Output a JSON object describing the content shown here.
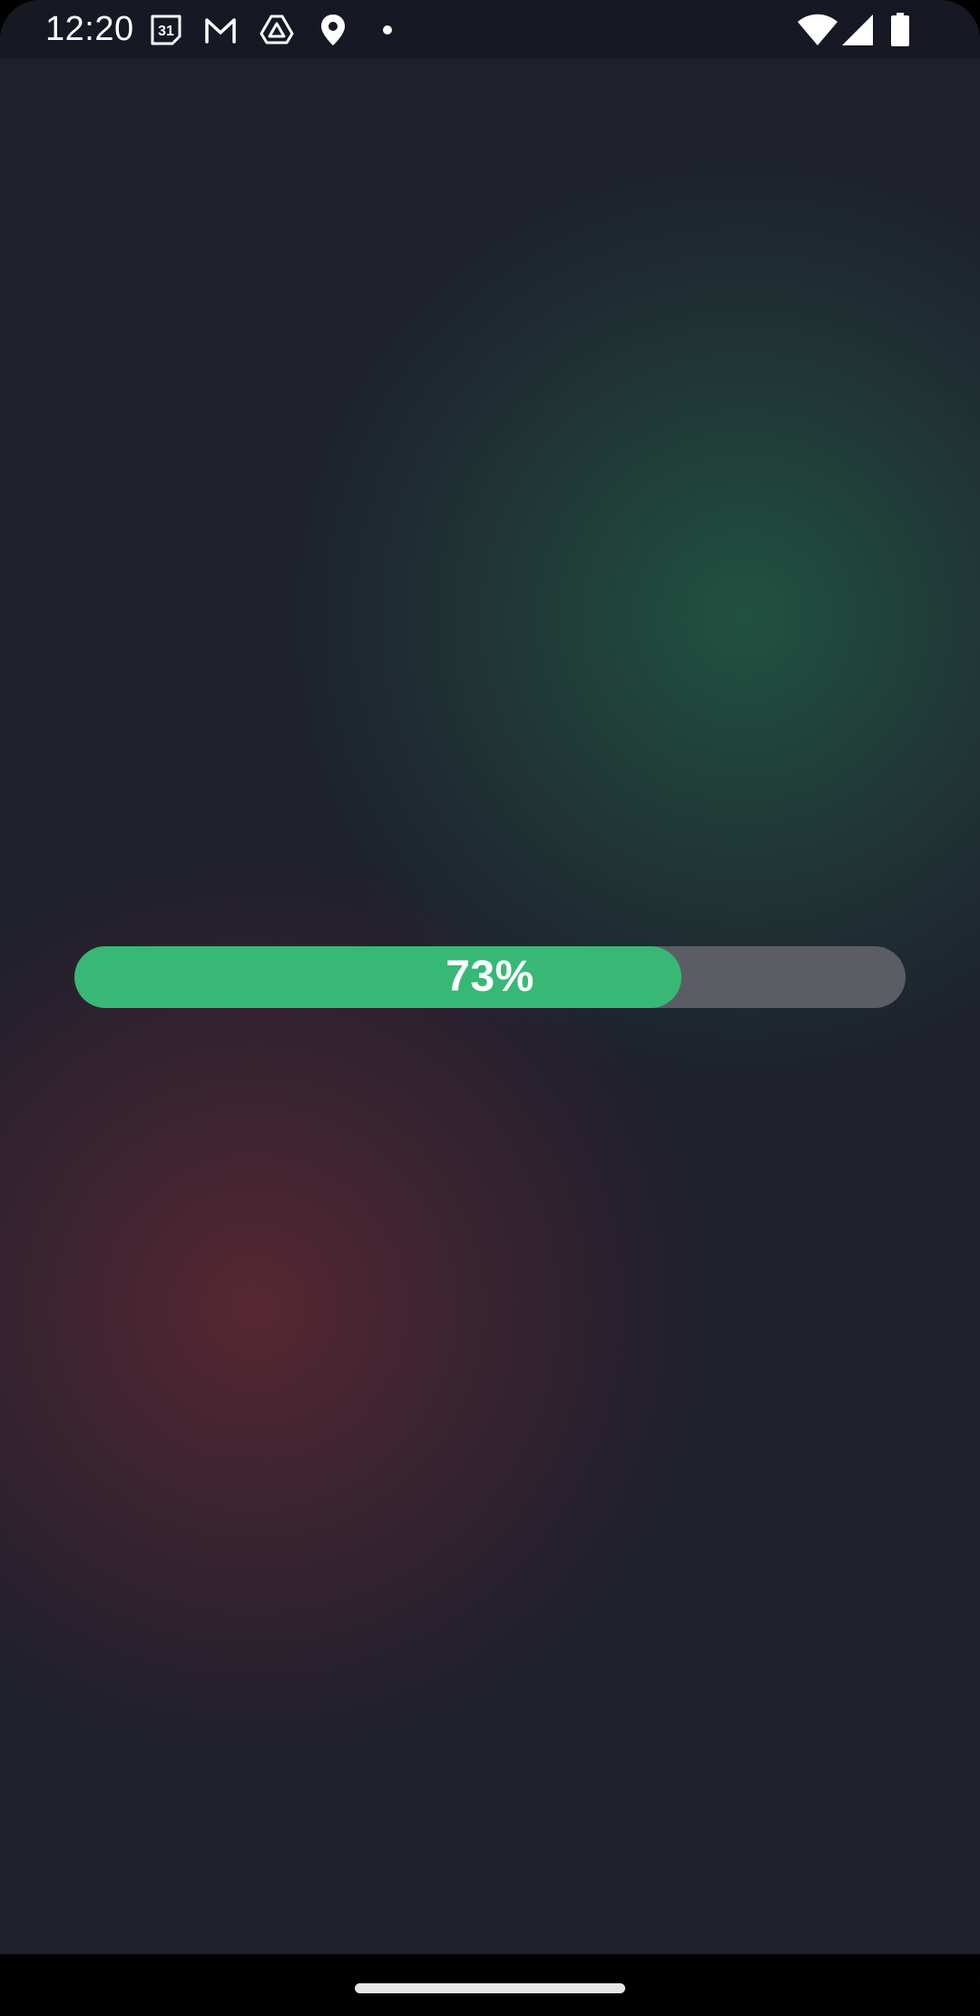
{
  "status_bar": {
    "time": "12:20",
    "notification_icons": [
      "calendar-icon",
      "gmail-icon",
      "drive-icon",
      "location-pin-icon",
      "more-dot-icon"
    ],
    "calendar_day": "31",
    "system_icons": [
      "wifi-icon",
      "cellular-signal-icon",
      "battery-icon"
    ]
  },
  "progress": {
    "value": 0.73,
    "label": "73%",
    "fill_color": "#37b975",
    "track_color": "#5c5d64"
  },
  "theme": {
    "background": "#1e202c",
    "glow_green": "#225442",
    "glow_red": "#5c2834"
  }
}
